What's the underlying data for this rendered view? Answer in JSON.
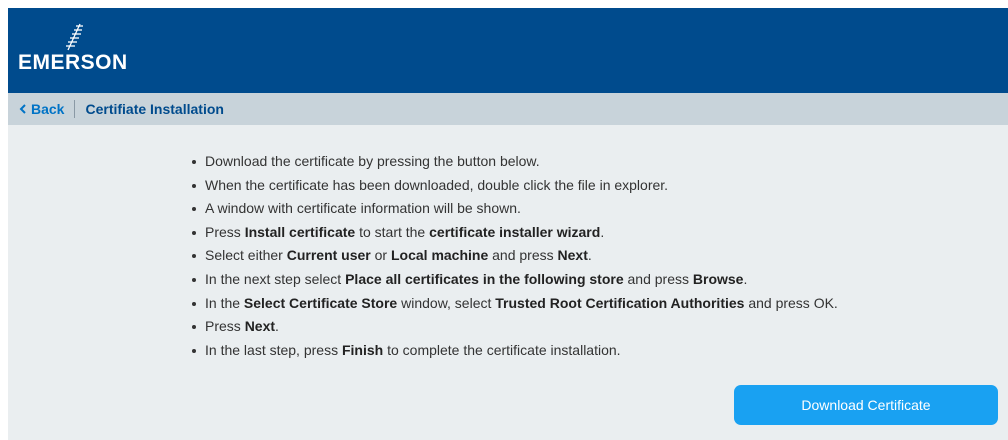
{
  "brand": {
    "name": "EMERSON",
    "header_color": "#004b8d",
    "accent_color": "#19a1f2"
  },
  "nav": {
    "back_label": "Back",
    "back_icon": "chevron-left-icon",
    "page_title": "Certifiate Installation"
  },
  "instructions": [
    [
      {
        "t": "Download the certificate by pressing the button below."
      }
    ],
    [
      {
        "t": "When the certificate has been downloaded, double click the file in explorer."
      }
    ],
    [
      {
        "t": "A window with certificate information will be shown."
      }
    ],
    [
      {
        "t": "Press "
      },
      {
        "t": "Install certificate",
        "b": true
      },
      {
        "t": " to start the "
      },
      {
        "t": "certificate installer wizard",
        "b": true
      },
      {
        "t": "."
      }
    ],
    [
      {
        "t": "Select either "
      },
      {
        "t": "Current user",
        "b": true
      },
      {
        "t": " or "
      },
      {
        "t": "Local machine",
        "b": true
      },
      {
        "t": " and press "
      },
      {
        "t": "Next",
        "b": true
      },
      {
        "t": "."
      }
    ],
    [
      {
        "t": "In the next step select "
      },
      {
        "t": "Place all certificates in the following store",
        "b": true
      },
      {
        "t": " and press "
      },
      {
        "t": "Browse",
        "b": true
      },
      {
        "t": "."
      }
    ],
    [
      {
        "t": "In the "
      },
      {
        "t": "Select Certificate Store",
        "b": true
      },
      {
        "t": " window, select "
      },
      {
        "t": "Trusted Root Certification Authorities",
        "b": true
      },
      {
        "t": " and press OK."
      }
    ],
    [
      {
        "t": "Press "
      },
      {
        "t": "Next",
        "b": true
      },
      {
        "t": "."
      }
    ],
    [
      {
        "t": "In the last step, press "
      },
      {
        "t": "Finish",
        "b": true
      },
      {
        "t": " to complete the certificate installation."
      }
    ]
  ],
  "download_button": {
    "label": "Download Certificate"
  }
}
